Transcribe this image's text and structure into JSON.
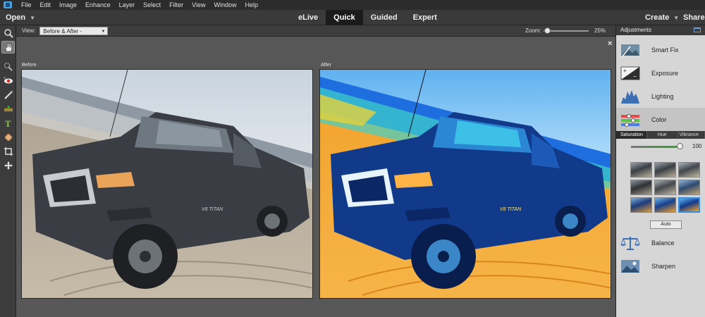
{
  "menu": {
    "items": [
      "File",
      "Edit",
      "Image",
      "Enhance",
      "Layer",
      "Select",
      "Filter",
      "View",
      "Window",
      "Help"
    ]
  },
  "modebar": {
    "open_label": "Open",
    "tabs": [
      "eLive",
      "Quick",
      "Guided",
      "Expert"
    ],
    "active_tab": "Quick",
    "create_label": "Create",
    "share_label": "Share"
  },
  "tools": [
    "zoom-tool-icon",
    "hand-tool-icon",
    "quick-selection-icon",
    "red-eye-icon",
    "whiten-teeth-icon",
    "straighten-icon",
    "type-icon",
    "spot-healing-icon",
    "crop-icon",
    "move-icon"
  ],
  "options": {
    "view_label": "View:",
    "view_value": "Before & After - Horizontal",
    "zoom_label": "Zoom:",
    "zoom_value": "25%",
    "zoom_fraction": 0.02
  },
  "canvas": {
    "before_label": "Before",
    "after_label": "After",
    "close_label": "×"
  },
  "adjustments": {
    "header": "Adjustments",
    "items": [
      {
        "label": "Smart Fix",
        "icon": "smart-fix-icon"
      },
      {
        "label": "Exposure",
        "icon": "exposure-icon"
      },
      {
        "label": "Lighting",
        "icon": "lighting-icon"
      },
      {
        "label": "Color",
        "icon": "color-icon"
      },
      {
        "label": "Balance",
        "icon": "balance-icon"
      },
      {
        "label": "Sharpen",
        "icon": "sharpen-icon"
      }
    ],
    "selected": "Color",
    "subtabs": [
      "Saturation",
      "Hue",
      "Vibrance"
    ],
    "active_subtab": "Saturation",
    "saturation_value": "100",
    "auto_label": "Auto"
  },
  "colors": {
    "accent": "#3b8ee0",
    "menubar": "#2c2c2c",
    "panel": "#d6d6d6"
  }
}
